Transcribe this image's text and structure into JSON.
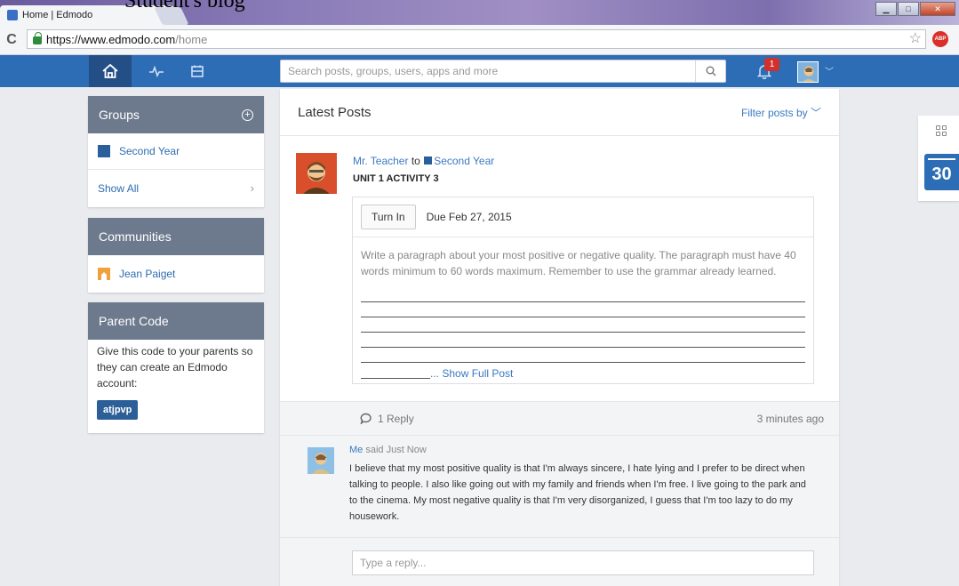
{
  "overlay_title": "Student's blog",
  "browser": {
    "tab_title": "Home | Edmodo",
    "tab_close": "×",
    "url_host": "https://www.edmodo.com",
    "url_path": "/home",
    "abp_label": "ABP"
  },
  "nav": {
    "search_placeholder": "Search posts, groups, users, apps and more",
    "notification_count": "1",
    "accent": "#2c6db5"
  },
  "sidebar": {
    "groups": {
      "title": "Groups",
      "items": [
        {
          "label": "Second Year",
          "color": "#2a5f9b"
        }
      ],
      "show_all": "Show All"
    },
    "communities": {
      "title": "Communities",
      "items": [
        {
          "label": "Jean Paiget",
          "color": "#f0a03c"
        }
      ]
    },
    "parent_code": {
      "title": "Parent Code",
      "text": "Give this code to your parents so they can create an Edmodo account:",
      "code": "atjpvp"
    }
  },
  "main": {
    "title": "Latest Posts",
    "filter_label": "Filter posts by",
    "post": {
      "author": "Mr. Teacher",
      "to_word": "to",
      "group": "Second Year",
      "title": "UNIT 1 ACTIVITY 3",
      "turn_in": "Turn In",
      "due": "Due Feb 27, 2015",
      "body": "Write a paragraph about your most positive or negative quality. The paragraph must have 40 words minimum to 60 words maximum. Remember to use the grammar already learned.",
      "show_full": "... Show Full Post",
      "reply_count": "1 Reply",
      "time": "3 minutes ago"
    },
    "reply": {
      "author": "Me",
      "said": "said Just Now",
      "text": "I believe that my most positive quality is that I'm always sincere, I hate lying and I prefer to be direct when talking to people. I also like going out with my family and friends when I'm free. I live going to the park and to the cinema. My most negative quality is that I'm very disorganized, I guess that I'm too lazy to do my housework."
    },
    "compose_placeholder": "Type a reply..."
  },
  "widget": {
    "calendar_day": "30"
  }
}
